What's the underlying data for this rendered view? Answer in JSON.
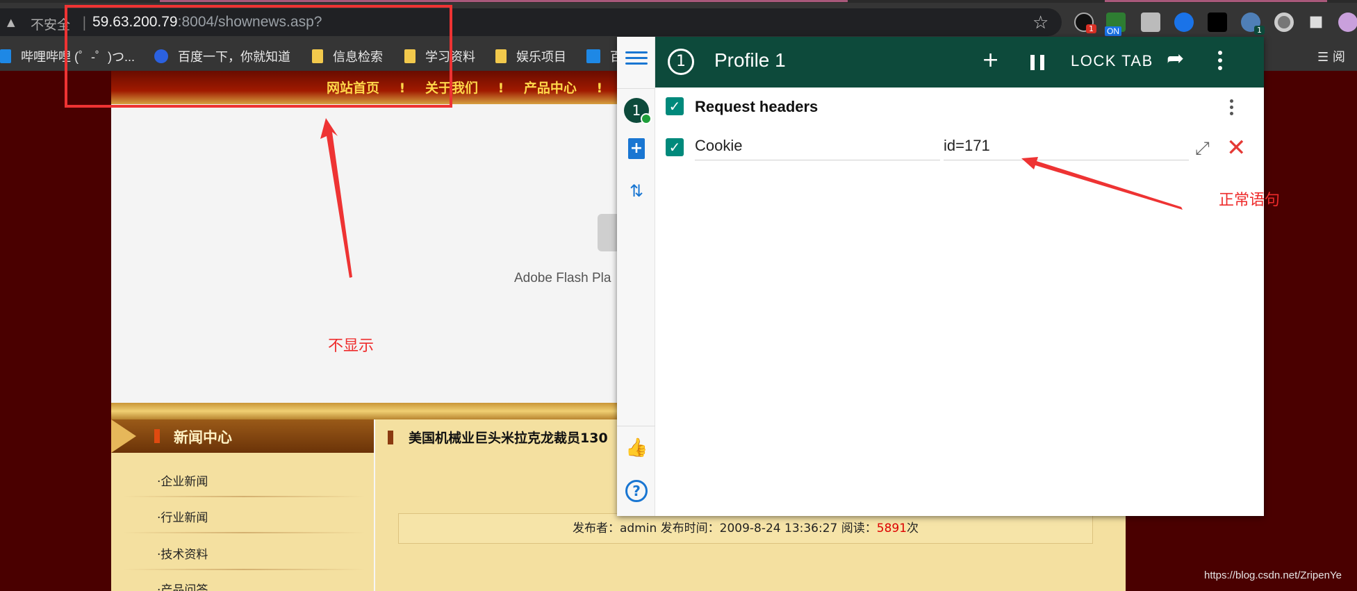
{
  "browser": {
    "insecure_label": "不安全",
    "separator": "|",
    "url_host": "59.63.200.79",
    "url_rest": ":8004/shownews.asp?",
    "ext_badge": "1",
    "ext_on": "ON",
    "ext_badge2": "1"
  },
  "bookmarks": [
    {
      "label": "哔哩哔哩 (゜-゜)つ..."
    },
    {
      "label": "百度一下，你就知道"
    },
    {
      "label": "信息检索"
    },
    {
      "label": "学习资料"
    },
    {
      "label": "娱乐项目"
    },
    {
      "label": "百"
    }
  ],
  "bookmarks_right": "阅",
  "site": {
    "nav": [
      "网站首页",
      "!",
      "关于我们",
      "!",
      "产品中心",
      "!"
    ],
    "flash_label": "Adobe Flash Pla",
    "left_title": "新闻中心",
    "menu": [
      "·企业新闻",
      "·行业新闻",
      "·技术资料",
      "·产品问答"
    ],
    "news_title": "美国机械业巨头米拉克龙裁员130",
    "meta_prefix": "发布者：admin 发布时间：2009-8-24 13:36:27 阅读：",
    "meta_count": "5891",
    "meta_suffix": "次"
  },
  "modheader": {
    "profile_number": "1",
    "profile_title": "Profile 1",
    "add_label": "+",
    "lock_tab": "LOCK TAB",
    "section_title": "Request headers",
    "header_name": "Cookie",
    "header_value": "id=171",
    "sidebar_profile": "1"
  },
  "annotations": {
    "left_note": "不显示",
    "right_note": "正常语句"
  },
  "watermark": "https://blog.csdn.net/ZripenYe",
  "colors": {
    "modheader_green": "#0d4a3b",
    "checkbox_teal": "#00897b",
    "annotation_red": "#ee2b2b"
  }
}
